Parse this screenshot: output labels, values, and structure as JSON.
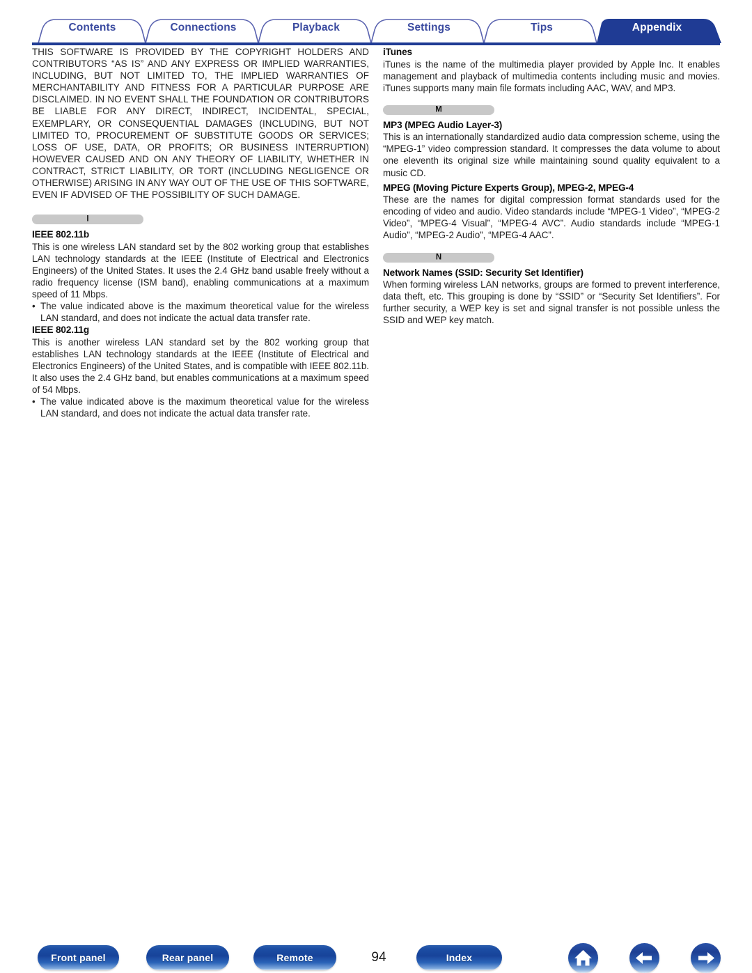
{
  "tabs": [
    {
      "label": "Contents",
      "active": false
    },
    {
      "label": "Connections",
      "active": false
    },
    {
      "label": "Playback",
      "active": false
    },
    {
      "label": "Settings",
      "active": false
    },
    {
      "label": "Tips",
      "active": false
    },
    {
      "label": "Appendix",
      "active": true
    }
  ],
  "colors": {
    "tab_text": "#3b4ba0",
    "tab_active_bg": "#1f3b94",
    "tab_active_text": "#ffffff",
    "tab_outline": "#5a63b0",
    "tab_baseline": "#1f3b94",
    "letter_bar_bg": "#c8c8c8",
    "button_blue": "#17439a",
    "body_text": "#232323"
  },
  "left_column": {
    "license_paragraph": "THIS SOFTWARE IS PROVIDED BY THE COPYRIGHT HOLDERS AND CONTRIBUTORS “AS IS” AND ANY EXPRESS OR IMPLIED WARRANTIES, INCLUDING, BUT NOT LIMITED TO, THE IMPLIED WARRANTIES OF MERCHANTABILITY AND FITNESS FOR A PARTICULAR PURPOSE ARE DISCLAIMED. IN NO EVENT SHALL THE FOUNDATION OR CONTRIBUTORS BE LIABLE FOR ANY DIRECT, INDIRECT, INCIDENTAL, SPECIAL, EXEMPLARY, OR CONSEQUENTIAL DAMAGES (INCLUDING, BUT NOT LIMITED TO, PROCUREMENT OF SUBSTITUTE GOODS OR SERVICES; LOSS OF USE, DATA, OR PROFITS; OR BUSINESS INTERRUPTION) HOWEVER CAUSED AND ON ANY THEORY OF LIABILITY, WHETHER IN CONTRACT, STRICT LIABILITY, OR TORT (INCLUDING NEGLIGENCE OR OTHERWISE) ARISING IN ANY WAY OUT OF THE USE OF THIS SOFTWARE, EVEN IF ADVISED OF THE POSSIBILITY OF SUCH DAMAGE.",
    "section_letter": "I",
    "entries": [
      {
        "term": "IEEE 802.11b",
        "text": "This is one wireless LAN standard set by the 802 working group that establishes LAN technology standards at the IEEE (Institute of Electrical and Electronics Engineers) of the United States. It uses the 2.4 GHz band usable freely without a radio frequency license (ISM band), enabling communications at a maximum speed of 11 Mbps.",
        "note": "The value indicated above is the maximum theoretical value for the wireless LAN standard, and does not indicate the actual data transfer rate."
      },
      {
        "term": "IEEE 802.11g",
        "text": "This is another wireless LAN standard set by the 802 working group that establishes LAN technology standards at the IEEE (Institute of Electrical and Electronics Engineers) of the United States, and is compatible with IEEE 802.11b. It also uses the 2.4 GHz band, but enables communications at a maximum speed of 54 Mbps.",
        "note": "The value indicated above is the maximum theoretical value for the wireless LAN standard, and does not indicate the actual data transfer rate."
      }
    ]
  },
  "right_column": {
    "itunes": {
      "term": "iTunes",
      "text": "iTunes is the name of the multimedia player provided by Apple Inc. It enables management and playback of multimedia contents including music and movies. iTunes supports many main file formats including AAC, WAV, and MP3."
    },
    "section_letter_m": "M",
    "mp3": {
      "term": "MP3 (MPEG Audio Layer-3)",
      "text": "This is an internationally standardized audio data compression scheme, using the “MPEG-1” video compression standard. It compresses the data volume to about one eleventh its original size while maintaining sound quality equivalent to a music CD."
    },
    "mpeg": {
      "term": "MPEG (Moving Picture Experts Group), MPEG-2, MPEG-4",
      "text": "These are the names for digital compression format standards used for the encoding of video and audio. Video standards include “MPEG-1 Video”, “MPEG-2 Video”, “MPEG-4 Visual”, “MPEG-4 AVC”. Audio standards include “MPEG-1 Audio”, “MPEG-2 Audio”, “MPEG-4 AAC”."
    },
    "section_letter_n": "N",
    "network_names": {
      "term": "Network Names (SSID: Security Set Identifier)",
      "text": "When forming wireless LAN networks, groups are formed to prevent interference, data theft, etc. This grouping is done by “SSID” or “Security Set Identifiers”. For further security, a WEP key is set and signal transfer is not possible unless the SSID and WEP key match."
    }
  },
  "footer": {
    "front_panel": "Front panel",
    "rear_panel": "Rear panel",
    "remote": "Remote",
    "page_number": "94",
    "index": "Index",
    "home_icon": "home-icon",
    "prev_icon": "arrow-left-icon",
    "next_icon": "arrow-right-icon"
  }
}
